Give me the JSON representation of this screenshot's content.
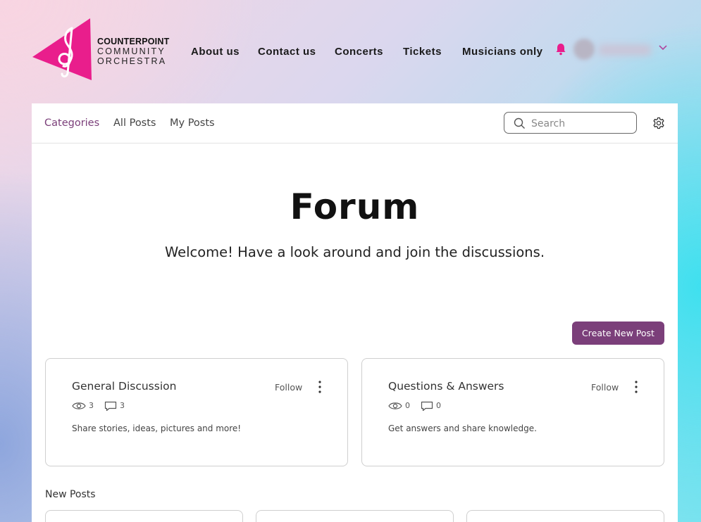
{
  "site": {
    "brand_line1": "COUNTERPOINT",
    "brand_line2": "COMMUNITY",
    "brand_line3": "ORCHESTRA",
    "logo_icon": "treble-clef-triangle-logo",
    "accent_color": "#e91e8c"
  },
  "nav": {
    "items": [
      {
        "label": "About us"
      },
      {
        "label": "Contact us"
      },
      {
        "label": "Concerts"
      },
      {
        "label": "Tickets"
      },
      {
        "label": "Musicians only"
      }
    ],
    "bell_icon": "bell-icon",
    "account_chevron_icon": "chevron-down-icon"
  },
  "forum": {
    "tabs": [
      {
        "label": "Categories",
        "active": true
      },
      {
        "label": "All Posts",
        "active": false
      },
      {
        "label": "My Posts",
        "active": false
      }
    ],
    "search_placeholder": "Search",
    "title": "Forum",
    "subtitle": "Welcome! Have a look around and join the discussions.",
    "create_button": "Create New Post",
    "button_color": "#7b3f7a",
    "categories": [
      {
        "name": "General Discussion",
        "follow": "Follow",
        "views": "3",
        "comments": "3",
        "description": "Share stories, ideas, pictures and more!"
      },
      {
        "name": "Questions & Answers",
        "follow": "Follow",
        "views": "0",
        "comments": "0",
        "description": "Get answers and share knowledge."
      }
    ],
    "new_posts_label": "New Posts"
  }
}
